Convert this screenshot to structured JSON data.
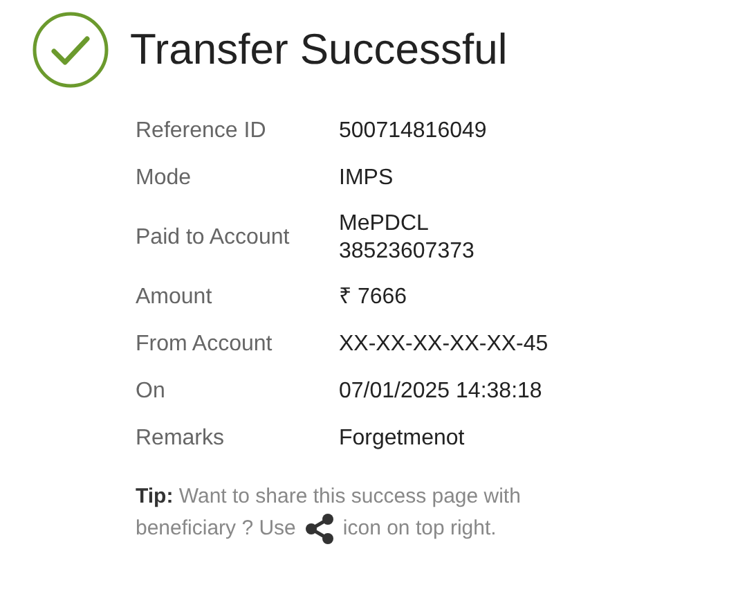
{
  "title": "Transfer Successful",
  "details": [
    {
      "label": "Reference ID",
      "value": [
        "500714816049"
      ]
    },
    {
      "label": "Mode",
      "value": [
        "IMPS"
      ]
    },
    {
      "label": "Paid to Account",
      "value": [
        "MePDCL",
        "38523607373"
      ]
    },
    {
      "label": "Amount",
      "value": [
        "₹ 7666"
      ]
    },
    {
      "label": "From Account",
      "value": [
        "XX-XX-XX-XX-XX-45"
      ]
    },
    {
      "label": "On",
      "value": [
        "07/01/2025 14:38:18"
      ]
    },
    {
      "label": "Remarks",
      "value": [
        "Forgetmenot"
      ]
    }
  ],
  "tip": {
    "first_line": "**Tip:** Want to share this success page with",
    "before": "beneficiary ? Use",
    "after": "icon on top right."
  }
}
